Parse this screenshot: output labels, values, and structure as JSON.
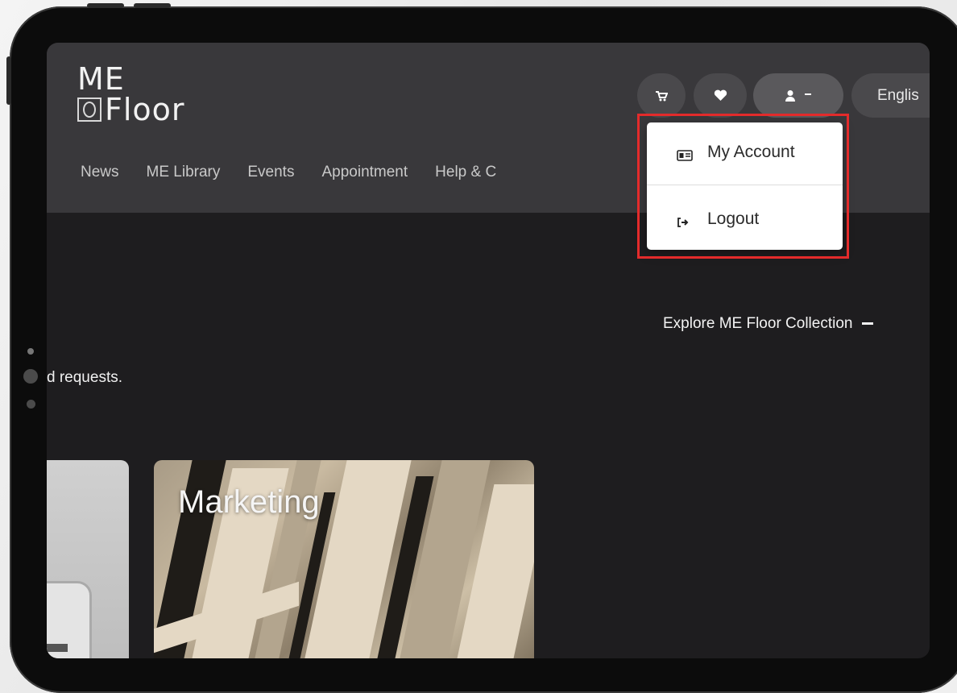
{
  "header": {
    "logo_line1": "ME",
    "logo_line2": "Floor",
    "language": "Englis"
  },
  "nav": {
    "items": [
      "News",
      "ME Library",
      "Events",
      "Appointment",
      "Help & C"
    ]
  },
  "hero": {
    "explore_link": "Explore ME Floor Collection",
    "requests_text": "d requests."
  },
  "cards": {
    "marketing_title": "Marketing"
  },
  "account_menu": {
    "items": [
      "My Account",
      "Logout"
    ]
  },
  "icons": {
    "cart": "cart-icon",
    "wishlist": "heart-icon",
    "user": "user-icon",
    "caret": "caret-down-icon",
    "account_card": "id-card-icon",
    "logout": "sign-out-icon"
  },
  "colors": {
    "highlight": "#e32b2b",
    "header_bg": "#39383b",
    "page_bg": "#1e1d1f"
  }
}
